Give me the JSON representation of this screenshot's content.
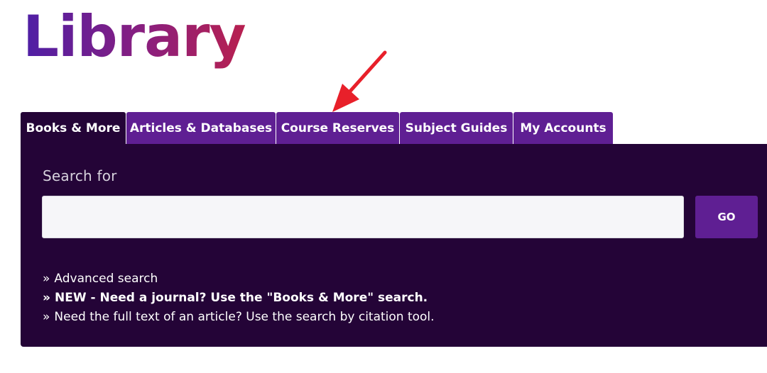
{
  "header": {
    "logo_text": "Library"
  },
  "tabs": [
    {
      "label": "Books & More",
      "active": true
    },
    {
      "label": "Articles & Databases",
      "active": false
    },
    {
      "label": "Course Reserves",
      "active": false
    },
    {
      "label": "Subject Guides",
      "active": false
    },
    {
      "label": "My Accounts",
      "active": false
    }
  ],
  "search": {
    "label": "Search for",
    "value": "",
    "placeholder": "",
    "go_label": "GO"
  },
  "links": {
    "bullet": "»",
    "advanced": "Advanced search",
    "journal_notice": "NEW - Need a journal? Use the \"Books & More\" search.",
    "fulltext_question": "Need the full text of an article?",
    "citation_tool": "Use the search by citation tool."
  },
  "colors": {
    "panel_bg": "#240437",
    "tab_bg": "#5f1f93",
    "go_bg": "#5f1f93",
    "annotation_arrow": "#e8202a"
  },
  "annotation": {
    "arrow_icon": "red-arrow-icon",
    "points_to": "Course Reserves"
  }
}
